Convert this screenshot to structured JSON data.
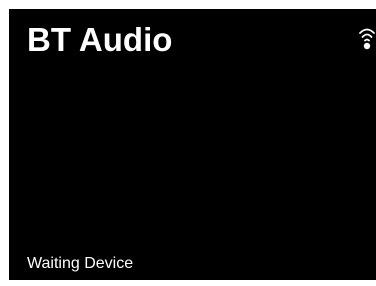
{
  "screen": {
    "title": "BT Audio",
    "status": "Waiting Device",
    "status_icon": "signal-icon",
    "colors": {
      "background": "#000000",
      "text": "#ffffff"
    }
  }
}
